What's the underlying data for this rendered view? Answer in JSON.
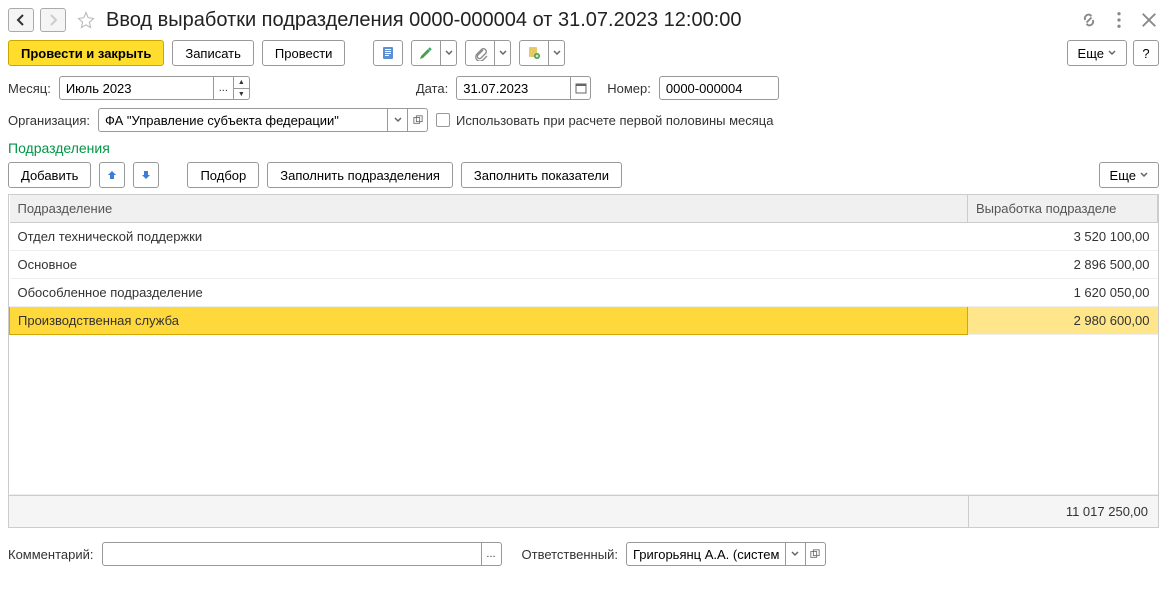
{
  "title": "Ввод выработки подразделения 0000-000004 от 31.07.2023 12:00:00",
  "toolbar": {
    "post_close": "Провести и закрыть",
    "save": "Записать",
    "post": "Провести",
    "more": "Еще",
    "help": "?"
  },
  "form": {
    "month_label": "Месяц:",
    "month_value": "Июль 2023",
    "date_label": "Дата:",
    "date_value": "31.07.2023",
    "number_label": "Номер:",
    "number_value": "0000-000004",
    "org_label": "Организация:",
    "org_value": "ФА \"Управление субъекта федерации\"",
    "use_half_label": "Использовать при расчете первой половины месяца"
  },
  "section": {
    "title": "Подразделения",
    "add": "Добавить",
    "pick": "Подбор",
    "fill_dept": "Заполнить подразделения",
    "fill_ind": "Заполнить показатели",
    "more": "Еще"
  },
  "table": {
    "col_dept": "Подразделение",
    "col_val": "Выработка подразделе",
    "rows": [
      {
        "dept": "Отдел технической поддержки",
        "val": "3 520 100,00"
      },
      {
        "dept": "Основное",
        "val": "2 896 500,00"
      },
      {
        "dept": "Обособленное подразделение",
        "val": "1 620 050,00"
      },
      {
        "dept": "Производственная служба",
        "val": "2 980 600,00"
      }
    ],
    "total": "11 017 250,00"
  },
  "bottom": {
    "comment_label": "Комментарий:",
    "comment_value": "",
    "resp_label": "Ответственный:",
    "resp_value": "Григорьянц А.А. (системн"
  }
}
